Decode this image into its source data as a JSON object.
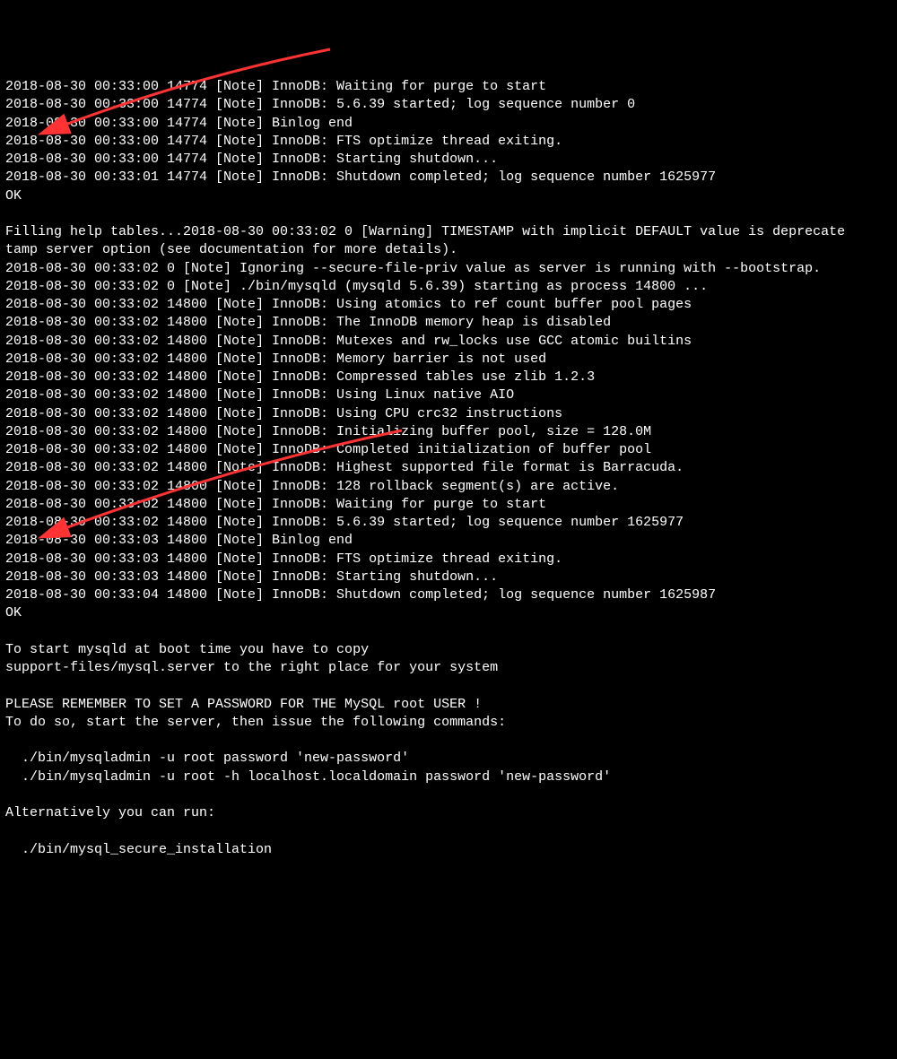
{
  "arrows": {
    "color": "#ff3333"
  },
  "lines": [
    "2018-08-30 00:33:00 14774 [Note] InnoDB: Waiting for purge to start",
    "2018-08-30 00:33:00 14774 [Note] InnoDB: 5.6.39 started; log sequence number 0",
    "2018-08-30 00:33:00 14774 [Note] Binlog end",
    "2018-08-30 00:33:00 14774 [Note] InnoDB: FTS optimize thread exiting.",
    "2018-08-30 00:33:00 14774 [Note] InnoDB: Starting shutdown...",
    "2018-08-30 00:33:01 14774 [Note] InnoDB: Shutdown completed; log sequence number 1625977",
    "OK",
    "",
    "Filling help tables...2018-08-30 00:33:02 0 [Warning] TIMESTAMP with implicit DEFAULT value is deprecate",
    "tamp server option (see documentation for more details).",
    "2018-08-30 00:33:02 0 [Note] Ignoring --secure-file-priv value as server is running with --bootstrap.",
    "2018-08-30 00:33:02 0 [Note] ./bin/mysqld (mysqld 5.6.39) starting as process 14800 ...",
    "2018-08-30 00:33:02 14800 [Note] InnoDB: Using atomics to ref count buffer pool pages",
    "2018-08-30 00:33:02 14800 [Note] InnoDB: The InnoDB memory heap is disabled",
    "2018-08-30 00:33:02 14800 [Note] InnoDB: Mutexes and rw_locks use GCC atomic builtins",
    "2018-08-30 00:33:02 14800 [Note] InnoDB: Memory barrier is not used",
    "2018-08-30 00:33:02 14800 [Note] InnoDB: Compressed tables use zlib 1.2.3",
    "2018-08-30 00:33:02 14800 [Note] InnoDB: Using Linux native AIO",
    "2018-08-30 00:33:02 14800 [Note] InnoDB: Using CPU crc32 instructions",
    "2018-08-30 00:33:02 14800 [Note] InnoDB: Initializing buffer pool, size = 128.0M",
    "2018-08-30 00:33:02 14800 [Note] InnoDB: Completed initialization of buffer pool",
    "2018-08-30 00:33:02 14800 [Note] InnoDB: Highest supported file format is Barracuda.",
    "2018-08-30 00:33:02 14800 [Note] InnoDB: 128 rollback segment(s) are active.",
    "2018-08-30 00:33:02 14800 [Note] InnoDB: Waiting for purge to start",
    "2018-08-30 00:33:02 14800 [Note] InnoDB: 5.6.39 started; log sequence number 1625977",
    "2018-08-30 00:33:03 14800 [Note] Binlog end",
    "2018-08-30 00:33:03 14800 [Note] InnoDB: FTS optimize thread exiting.",
    "2018-08-30 00:33:03 14800 [Note] InnoDB: Starting shutdown...",
    "2018-08-30 00:33:04 14800 [Note] InnoDB: Shutdown completed; log sequence number 1625987",
    "OK",
    "",
    "To start mysqld at boot time you have to copy",
    "support-files/mysql.server to the right place for your system",
    "",
    "PLEASE REMEMBER TO SET A PASSWORD FOR THE MySQL root USER !",
    "To do so, start the server, then issue the following commands:",
    "",
    "  ./bin/mysqladmin -u root password 'new-password'",
    "  ./bin/mysqladmin -u root -h localhost.localdomain password 'new-password'",
    "",
    "Alternatively you can run:",
    "",
    "  ./bin/mysql_secure_installation"
  ]
}
